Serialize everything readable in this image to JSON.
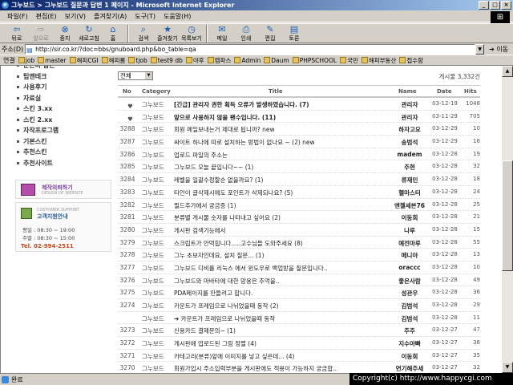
{
  "window": {
    "title": "그누보드 > 그누보드 질문과 답변 1 페이지 - Microsoft Internet Explorer",
    "buttons": [
      "_",
      "□",
      "×"
    ]
  },
  "menu": [
    "파일(F)",
    "편집(E)",
    "보기(V)",
    "즐겨찾기(A)",
    "도구(T)",
    "도움말(H)"
  ],
  "toolbar": [
    {
      "label": "뒤로",
      "icon": "back-arrow-icon",
      "glyph": "⇦",
      "enabled": true
    },
    {
      "label": "앞으로",
      "icon": "forward-arrow-icon",
      "glyph": "⇨",
      "enabled": false
    },
    {
      "label": "중지",
      "icon": "stop-icon",
      "glyph": "⊗",
      "enabled": true
    },
    {
      "label": "새로고침",
      "icon": "refresh-icon",
      "glyph": "↻",
      "enabled": true
    },
    {
      "label": "홈",
      "icon": "home-icon",
      "glyph": "⌂",
      "enabled": true
    },
    {
      "label": "검색",
      "icon": "search-icon",
      "glyph": "⌕",
      "enabled": true
    },
    {
      "label": "즐겨찾기",
      "icon": "favorites-icon",
      "glyph": "★",
      "enabled": true
    },
    {
      "label": "목록보기",
      "icon": "history-icon",
      "glyph": "◷",
      "enabled": true
    },
    {
      "label": "메일",
      "icon": "mail-icon",
      "glyph": "✉",
      "enabled": true
    },
    {
      "label": "인쇄",
      "icon": "print-icon",
      "glyph": "⎙",
      "enabled": true
    },
    {
      "label": "편집",
      "icon": "edit-icon",
      "glyph": "✎",
      "enabled": true
    },
    {
      "label": "토론",
      "icon": "discuss-icon",
      "glyph": "▤",
      "enabled": true
    }
  ],
  "address": {
    "label": "주소(D)",
    "url": "http://sir.co.kr/?doc=bbs/gnuboard.php&bo_table=qa",
    "go": "이동"
  },
  "links": {
    "label": "연결",
    "items": [
      "job",
      "master",
      "해피CGI",
      "해피롬",
      "tjob",
      "test9 db",
      "야후",
      "엠파스",
      "Admin",
      "Daum",
      "PHPSCHOOL",
      "국민",
      "해피부동산",
      "접수함"
    ]
  },
  "sidebar": {
    "items": [
      "문곤바 갑곤",
      "팁앤테크",
      "사용후기",
      "자료실",
      "스킨 3.xx",
      "스킨 2.xx",
      "자작프로그램",
      "기본스킨",
      "추천스킨",
      "추천사이트"
    ],
    "category_banner": {
      "title": "제작의뢰하기",
      "sub": "DESIGN OF WEBSITE"
    },
    "support": {
      "eng": "CUSTOMER SUPPORT",
      "title": "고객지원안내",
      "weekday": "평일 : 08:30 ~ 19:00",
      "weekend": "주말 : 08:30 ~ 15:00",
      "tel": "Tel. 02-994-2511"
    }
  },
  "board": {
    "select": "전체",
    "count": "게시물 3,332건",
    "headers": {
      "no": "No",
      "category": "Category",
      "title": "Title",
      "name": "Name",
      "date": "Date",
      "hits": "Hits"
    },
    "rows": [
      {
        "no": "",
        "category": "그누보드",
        "title": "[긴급] 관리자 권한 획득 오류가 발생하였습니다. (7)",
        "name": "관리자",
        "date": "03-12-19",
        "hits": "1048",
        "notice": true
      },
      {
        "no": "",
        "category": "그누보드",
        "title": "앞으로 사용하지 않을 팬수입니다. (11)",
        "name": "관리자",
        "date": "03-11-29",
        "hits": "705",
        "notice": true
      },
      {
        "no": "3288",
        "category": "그누보드",
        "title": "회원 메일보내는거 제대로 됩니까? new",
        "name": "하자고요",
        "date": "03-12-29",
        "hits": "10"
      },
      {
        "no": "3287",
        "category": "그누보드",
        "title": "싸이트 하나에 따로 설치하는 방법이 없나요 ~ (2) new",
        "name": "송범석",
        "date": "03-12-29",
        "hits": "16"
      },
      {
        "no": "3286",
        "category": "그누보드",
        "title": "업로드 파일의 주소는",
        "name": "madem",
        "date": "03-12-28",
        "hits": "19"
      },
      {
        "no": "3285",
        "category": "그누보드",
        "title": "그누보드 오늘 끝입니다~~ (1)",
        "name": "주현",
        "date": "03-12-28",
        "hits": "32"
      },
      {
        "no": "3284",
        "category": "그누보드",
        "title": "레벨을 일괄수정할순 없을까요? (1)",
        "name": "류재민",
        "date": "03-12-28",
        "hits": "18"
      },
      {
        "no": "3283",
        "category": "그누보드",
        "title": "타인이 글삭제시에도 포인트가 삭제되나요? (5)",
        "name": "헬마스터",
        "date": "03-12-28",
        "hits": "24"
      },
      {
        "no": "3282",
        "category": "그누보드",
        "title": "필드추가에서 궁금증 (1)",
        "name": "엔젤세븐76",
        "date": "03-12-28",
        "hits": "25"
      },
      {
        "no": "3281",
        "category": "그누보드",
        "title": "분류별 게시물 숫자를 나타내고 싶어요 (2)",
        "name": "이동희",
        "date": "03-12-28",
        "hits": "21"
      },
      {
        "no": "3280",
        "category": "그누보드",
        "title": "게시판 검색기능에서",
        "name": "나루",
        "date": "03-12-28",
        "hits": "15"
      },
      {
        "no": "3279",
        "category": "그누보드",
        "title": "스크립트가 안먹힙니다.....고수님들 도와주세요 (8)",
        "name": "예전마루",
        "date": "03-12-28",
        "hits": "55"
      },
      {
        "no": "3278",
        "category": "그누보드",
        "title": "그누 초보자인데요, 설치 질문... (1)",
        "name": "메니아",
        "date": "03-12-28",
        "hits": "13"
      },
      {
        "no": "3277",
        "category": "그누보드",
        "title": "그누보드 디비를 리눅스 에서 윈도우로 백업받을 질문입니다..",
        "name": "oraccc",
        "date": "03-12-28",
        "hits": "10"
      },
      {
        "no": "3276",
        "category": "그누보드",
        "title": "그누보드와 마바타에 대한 망용은 추억을..",
        "name": "좋은사람",
        "date": "03-12-28",
        "hits": "49"
      },
      {
        "no": "3275",
        "category": "그누보드",
        "title": "PDA페이지를 만들려고 합니다.",
        "name": "성관우",
        "date": "03-12-28",
        "hits": "36"
      },
      {
        "no": "3274",
        "category": "그누보드",
        "title": "카운트가 프레임으로 나뉘었을때 동작 (2)",
        "name": "김범석",
        "date": "03-12-28",
        "hits": "29"
      },
      {
        "no": "",
        "category": "그누보드",
        "title": "➔ 카운트가 프레임으로 나뉘었을때 동작",
        "name": "김범석",
        "date": "03-12-28",
        "hits": "11"
      },
      {
        "no": "3273",
        "category": "그누보드",
        "title": "신용카드 결제문의~ (1)",
        "name": "주주",
        "date": "03-12-27",
        "hits": "47"
      },
      {
        "no": "3272",
        "category": "그누보드",
        "title": "게시판에 업로드된 그림 정렬 (4)",
        "name": "지수아빠",
        "date": "03-12-27",
        "hits": "36"
      },
      {
        "no": "3271",
        "category": "그누보드",
        "title": "카테고리(분류)앞에 이미지를 넣고 싶은데... (4)",
        "name": "이동희",
        "date": "03-12-27",
        "hits": "35"
      },
      {
        "no": "3270",
        "category": "그누보드",
        "title": "회원가입시 주소입력부분을 게시판에도 적용이 가능하지 궁금합..",
        "name": "연기해주세",
        "date": "03-12-27",
        "hits": "32"
      }
    ]
  },
  "status": {
    "text": "완료"
  },
  "copyright": "Copyright(c) http://www.happycgi.com"
}
